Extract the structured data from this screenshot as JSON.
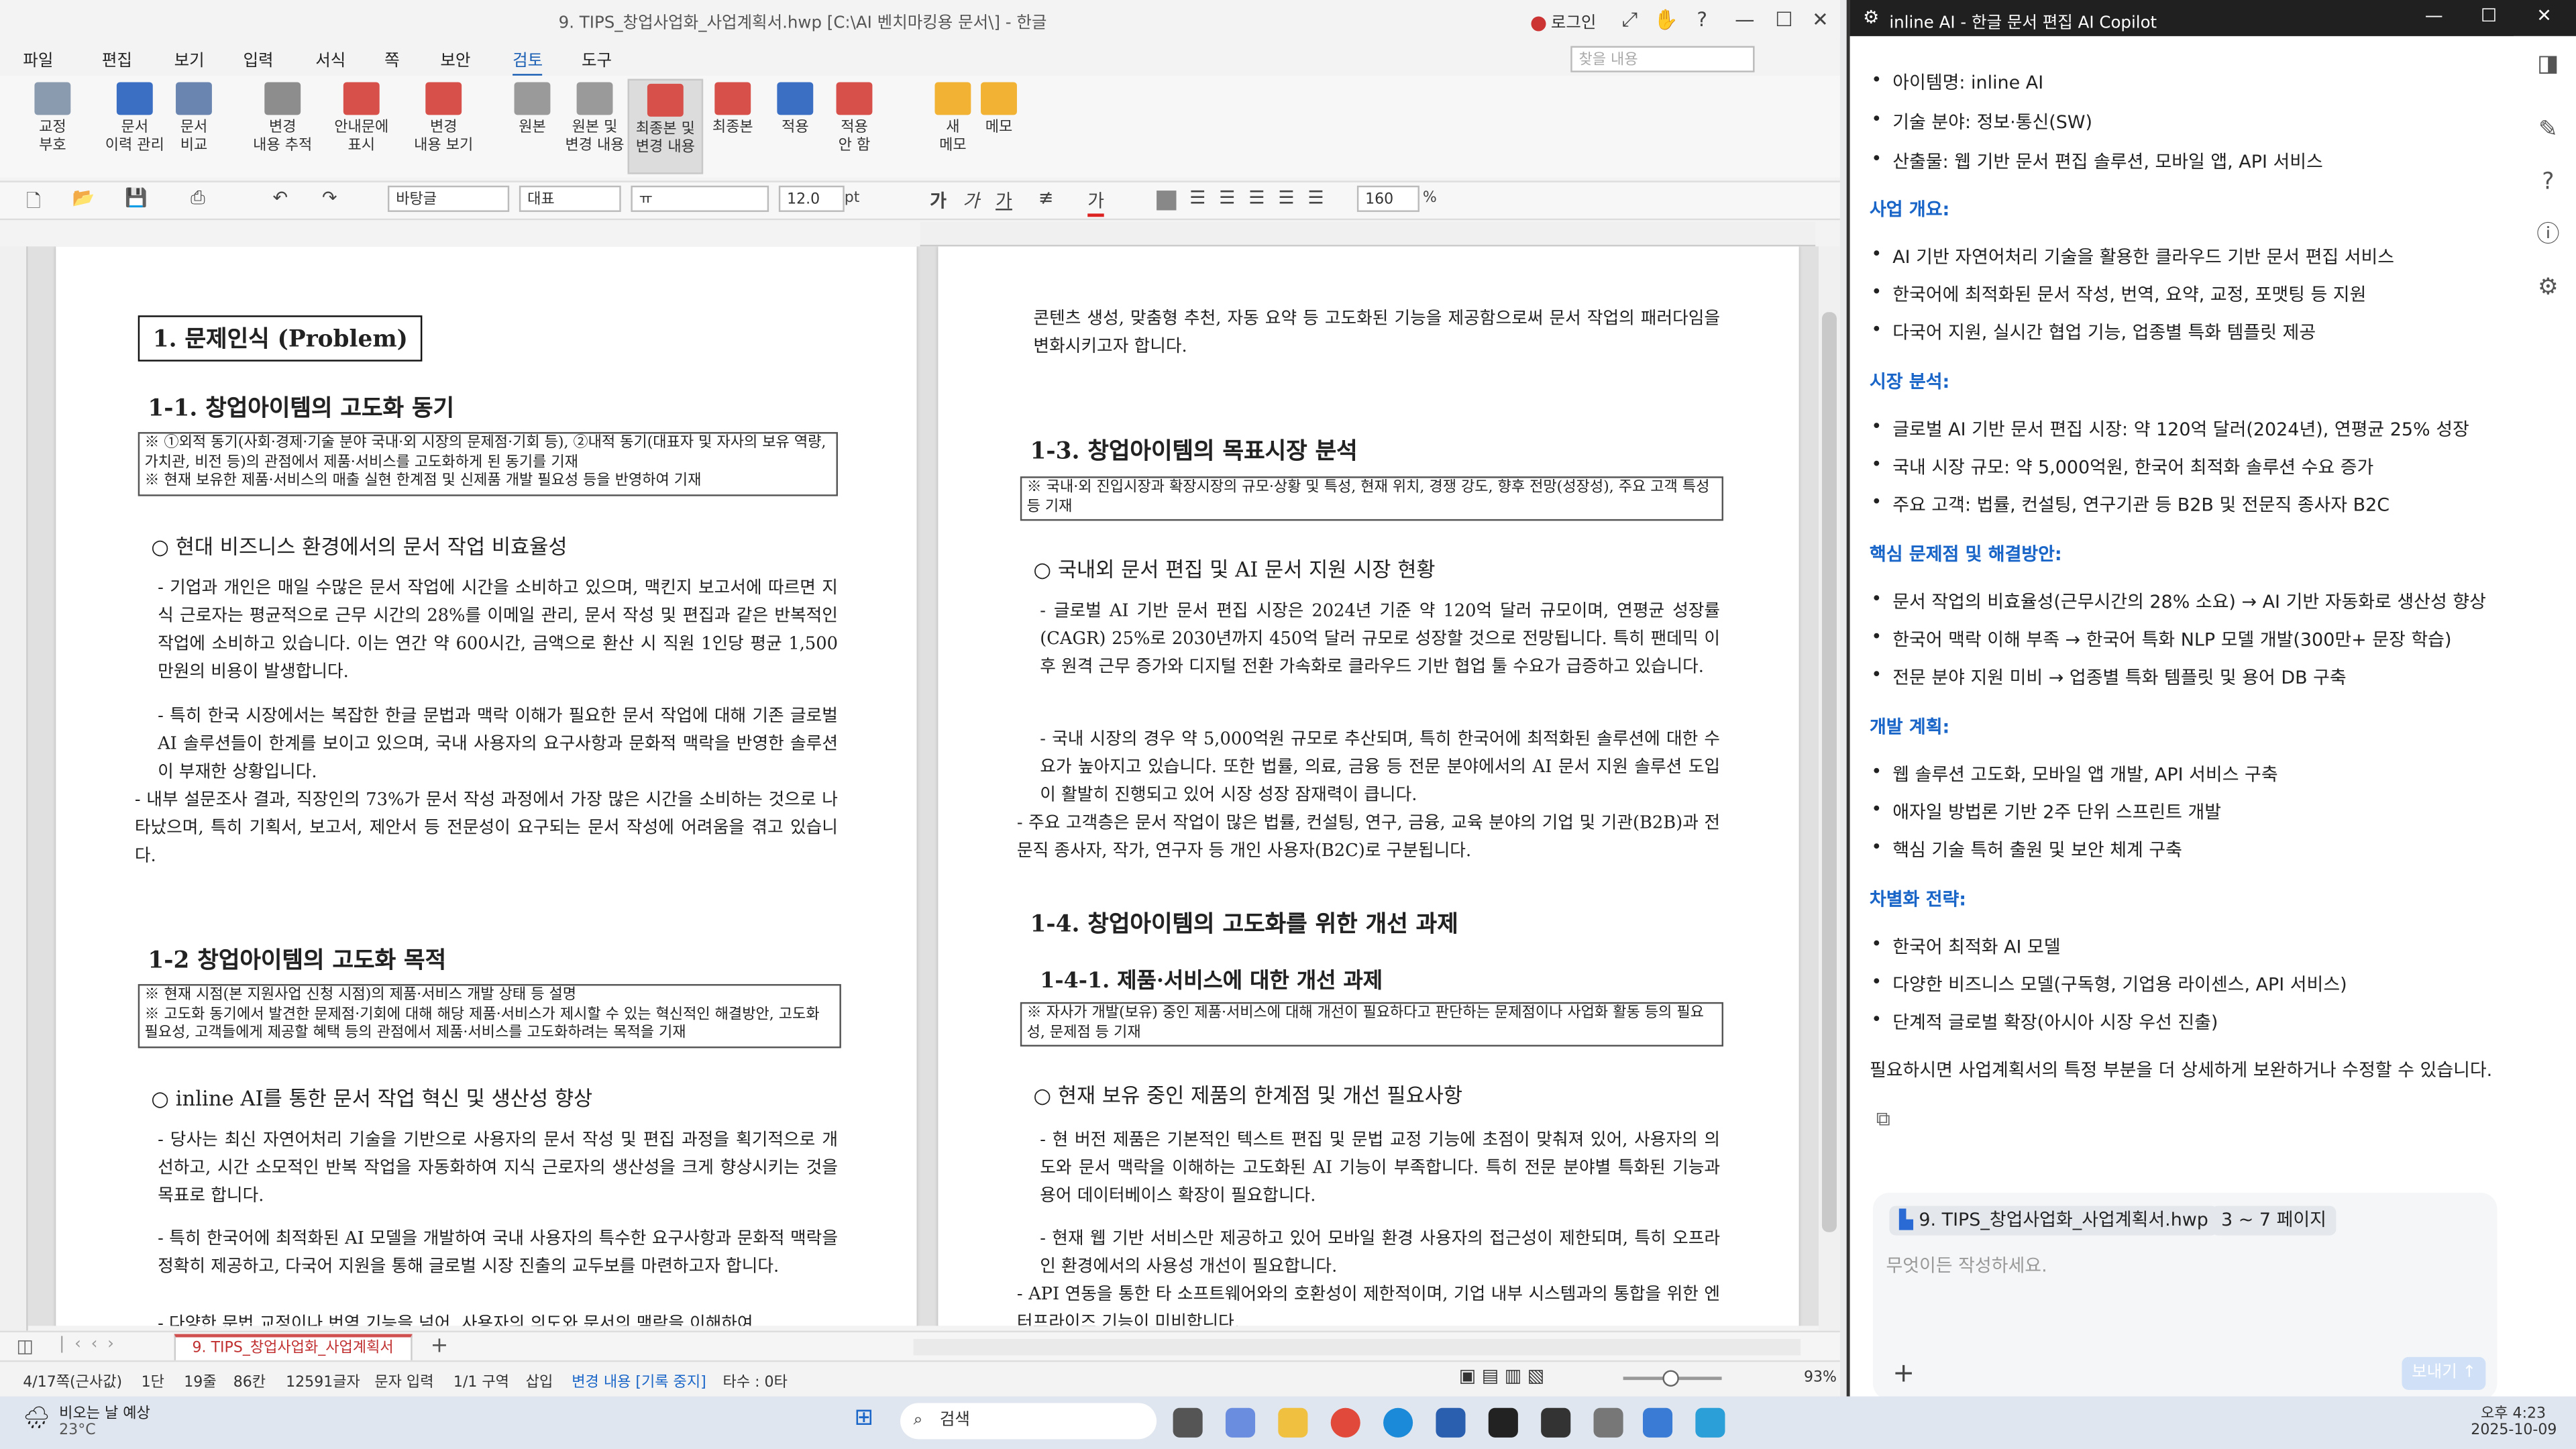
{
  "hwp": {
    "title": "9. TIPS_창업사업화_사업계획서.hwp [C:\\AI 벤치마킹용 문서\\] - 한글",
    "login": "로그인",
    "menus": [
      "파일",
      "편집",
      "보기",
      "입력",
      "서식",
      "쪽",
      "보안",
      "검토",
      "도구"
    ],
    "active_menu": "검토",
    "search_placeholder": "찾을 내용",
    "ribbon": [
      {
        "label": "교정\n부호"
      },
      {
        "label": "문서\n이력 관리"
      },
      {
        "label": "문서\n비교"
      },
      {
        "label": "변경\n내용 추적"
      },
      {
        "label": "안내문에\n표시"
      },
      {
        "label": "변경\n내용 보기"
      },
      {
        "label": "원본"
      },
      {
        "label": "원본 및\n변경 내용"
      },
      {
        "label": "최종본 및\n변경 내용"
      },
      {
        "label": "최종본"
      },
      {
        "label": "적용"
      },
      {
        "label": "적용\n안 함"
      },
      {
        "label": "새\n메모"
      },
      {
        "label": "메모"
      }
    ],
    "format": {
      "style": "바탕글",
      "lang": "대표",
      "font": "ㅠ",
      "size": "12.0",
      "unit": "pt",
      "zoom": "160",
      "zoom_unit": "%"
    },
    "status": {
      "page": "4/17쪽(근사값)",
      "col": "1단",
      "line": "19줄",
      "pos": "86칸",
      "chars": "12591글자",
      "mode": "문자 입력",
      "section": "1/1 구역",
      "insert": "삽입",
      "track": "변경 내용 [기록 중지]",
      "typos": "타수 : 0타",
      "zoom": "93%"
    },
    "tab": "9. TIPS_창업사업화_사업계획서"
  },
  "page_left": {
    "h1": "1. 문제인식 (Problem)",
    "h2a": "1-1. 창업아이템의 고도화 동기",
    "note1": [
      "※ ①외적 동기(사회·경제·기술 분야 국내·외 시장의 문제점·기회 등), ②내적 동기(대표자 및 자사의 보유 역량, 가치관, 비전 등)의 관점에서 제품·서비스를 고도화하게 된 동기를 기재",
      "※ 현재 보유한 제품·서비스의 매출 실현 한계점 및 신제품 개발 필요성 등을 반영하여 기재"
    ],
    "h3a": "○ 현대 비즈니스 환경에서의 문서 작업 비효율성",
    "p1": "- 기업과 개인은 매일 수많은 문서 작업에 시간을 소비하고 있으며, 맥킨지 보고서에 따르면 지식 근로자는 평균적으로 근무 시간의 28%를 이메일 관리, 문서 작성 및 편집과 같은 반복적인 작업에 소비하고 있습니다. 이는 연간 약 600시간, 금액으로 환산 시 직원 1인당 평균 1,500만원의 비용이 발생합니다.",
    "p2": "- 특히 한국 시장에서는 복잡한 한글 문법과 맥락 이해가 필요한 문서 작업에 대해 기존 글로벌 AI 솔루션들이 한계를 보이고 있으며, 국내 사용자의 요구사항과 문화적 맥락을 반영한 솔루션이 부재한 상황입니다.",
    "p3": "- 내부 설문조사 결과, 직장인의 73%가 문서 작성 과정에서 가장 많은 시간을 소비하는 것으로 나타났으며, 특히 기획서, 보고서, 제안서 등 전문성이 요구되는 문서 작성에 어려움을 겪고 있습니다.",
    "h2b": "1-2 창업아이템의 고도화 목적",
    "note2": [
      "※ 현재 시점(본 지원사업 신청 시점)의 제품·서비스 개발 상태 등 설명",
      "※ 고도화 동기에서 발견한 문제점·기회에 대해 해당 제품·서비스가 제시할 수 있는 혁신적인 해결방안, 고도화 필요성, 고객들에게 제공할 혜택 등의 관점에서 제품·서비스를 고도화하려는 목적을 기재"
    ],
    "h3b": "○ inline AI를 통한 문서 작업 혁신 및 생산성 향상",
    "p4": "- 당사는 최신 자연어처리 기술을 기반으로 사용자의 문서 작성 및 편집 과정을 획기적으로 개선하고, 시간 소모적인 반복 작업을 자동화하여 지식 근로자의 생산성을 크게 향상시키는 것을 목표로 합니다.",
    "p5": "- 특히 한국어에 최적화된 AI 모델을 개발하여 국내 사용자의 특수한 요구사항과 문화적 맥락을 정확히 제공하고, 다국어 지원을 통해 글로벌 시장 진출의 교두보를 마련하고자 합니다.",
    "p6": "- 다양한 문법 교정이나 번역 기능을 넘어, 사용자의 의도와 문서의 맥락을 이해하여"
  },
  "page_right": {
    "p0": "콘텐츠 생성, 맞춤형 추천, 자동 요약 등 고도화된 기능을 제공함으로써 문서 작업의 패러다임을 변화시키고자 합니다.",
    "h2a": "1-3. 창업아이템의 목표시장 분석",
    "note1": [
      "※ 국내·외 진입시장과 확장시장의 규모·상황 및 특성, 현재 위치, 경쟁 강도, 향후 전망(성장성), 주요 고객 특성 등 기재"
    ],
    "h3a": "○ 국내외 문서 편집 및 AI 문서 지원 시장 현황",
    "p1": "- 글로벌 AI 기반 문서 편집 시장은 2024년 기준 약 120억 달러 규모이며, 연평균 성장률(CAGR) 25%로 2030년까지 450억 달러 규모로 성장할 것으로 전망됩니다. 특히 팬데믹 이후 원격 근무 증가와 디지털 전환 가속화로 클라우드 기반 협업 툴 수요가 급증하고 있습니다.",
    "p2": "- 국내 시장의 경우 약 5,000억원 규모로 추산되며, 특히 한국어에 최적화된 솔루션에 대한 수요가 높아지고 있습니다. 또한 법률, 의료, 금융 등 전문 분야에서의 AI 문서 지원 솔루션 도입이 활발히 진행되고 있어 시장 성장 잠재력이 큽니다.",
    "p3": "- 주요 고객층은 문서 작업이 많은 법률, 컨설팅, 연구, 금융, 교육 분야의 기업 및 기관(B2B)과 전문직 종사자, 작가, 연구자 등 개인 사용자(B2C)로 구분됩니다.",
    "h2b": "1-4. 창업아이템의 고도화를 위한 개선 과제",
    "h2c": "1-4-1. 제품·서비스에 대한 개선 과제",
    "note2": [
      "※ 자사가 개발(보유) 중인 제품·서비스에 대해 개선이 필요하다고 판단하는 문제점이나 사업화 활동 등의 필요성, 문제점 등 기재"
    ],
    "h3b": "○ 현재 보유 중인 제품의 한계점 및 개선 필요사항",
    "p4": "- 현 버전 제품은 기본적인 텍스트 편집 및 문법 교정 기능에 초점이 맞춰져 있어, 사용자의 의도와 문서 맥락을 이해하는 고도화된 AI 기능이 부족합니다. 특히 전문 분야별 특화된 기능과 용어 데이터베이스 확장이 필요합니다.",
    "p5": "- 현재 웹 기반 서비스만 제공하고 있어 모바일 환경 사용자의 접근성이 제한되며, 특히 오프라인 환경에서의 사용성 개선이 필요합니다.",
    "p6": "- API 연동을 통한 타 소프트웨어와의 호환성이 제한적이며, 기업 내부 시스템과의 통합을 위한 엔터프라이즈 기능이 미비합니다."
  },
  "copilot": {
    "title": "inline AI - 한글 문서 편집 AI Copilot",
    "top_bullets": [
      "아이템명: inline AI",
      "기술 분야: 정보·통신(SW)",
      "산출물: 웹 기반 문서 편집 솔루션, 모바일 앱, API 서비스"
    ],
    "sections": [
      {
        "heading": "사업 개요:",
        "items": [
          "AI 기반 자연어처리 기술을 활용한 클라우드 기반 문서 편집 서비스",
          "한국어에 최적화된 문서 작성, 번역, 요약, 교정, 포맷팅 등 지원",
          "다국어 지원, 실시간 협업 기능, 업종별 특화 템플릿 제공"
        ]
      },
      {
        "heading": "시장 분석:",
        "items": [
          "글로벌 AI 기반 문서 편집 시장: 약 120억 달러(2024년), 연평균 25% 성장",
          "국내 시장 규모: 약 5,000억원, 한국어 최적화 솔루션 수요 증가",
          "주요 고객: 법률, 컨설팅, 연구기관 등 B2B 및 전문직 종사자 B2C"
        ]
      },
      {
        "heading": "핵심 문제점 및 해결방안:",
        "items": [
          "문서 작업의 비효율성(근무시간의 28% 소요) → AI 기반 자동화로 생산성 향상",
          "한국어 맥락 이해 부족 → 한국어 특화 NLP 모델 개발(300만+ 문장 학습)",
          "전문 분야 지원 미비 → 업종별 특화 템플릿 및 용어 DB 구축"
        ]
      },
      {
        "heading": "개발 계획:",
        "items": [
          "웹 솔루션 고도화, 모바일 앱 개발, API 서비스 구축",
          "애자일 방법론 기반 2주 단위 스프린트 개발",
          "핵심 기술 특허 출원 및 보안 체계 구축"
        ]
      },
      {
        "heading": "차별화 전략:",
        "items": [
          "한국어 최적화 AI 모델",
          "다양한 비즈니스 모델(구독형, 기업용 라이센스, API 서비스)",
          "단계적 글로벌 확장(아시아 시장 우선 진출)"
        ]
      }
    ],
    "closing": "필요하시면 사업계획서의 특정 부분을 더 상세하게 보완하거나 수정할 수 있습니다.",
    "chip_file": "9. TIPS_창업사업화_사업계획서.hwp",
    "chip_pages": "3 ~ 7 페이지",
    "placeholder": "무엇이든 작성하세요.",
    "send": "보내기 ↑"
  },
  "taskbar": {
    "weather": "비오는 날 예상",
    "temp": "23°C",
    "search": "검색",
    "time": "오후 4:23",
    "date": "2025-10-09"
  }
}
